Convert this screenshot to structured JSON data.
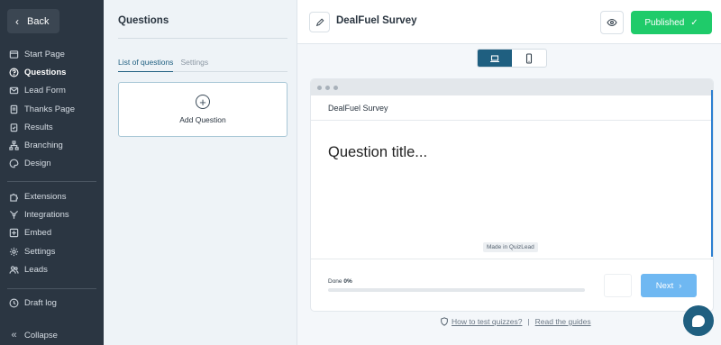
{
  "sidebar": {
    "back_label": "Back",
    "group1": [
      {
        "label": "Start Page",
        "icon": "start-page-icon"
      },
      {
        "label": "Questions",
        "icon": "question-circle-icon",
        "active": true
      },
      {
        "label": "Lead Form",
        "icon": "lead-form-icon"
      },
      {
        "label": "Thanks Page",
        "icon": "thanks-page-icon"
      },
      {
        "label": "Results",
        "icon": "results-icon"
      },
      {
        "label": "Branching",
        "icon": "branching-icon"
      },
      {
        "label": "Design",
        "icon": "palette-icon"
      }
    ],
    "group2": [
      {
        "label": "Extensions",
        "icon": "puzzle-icon"
      },
      {
        "label": "Integrations",
        "icon": "integrations-icon"
      },
      {
        "label": "Embed",
        "icon": "embed-icon"
      },
      {
        "label": "Settings",
        "icon": "gear-icon"
      },
      {
        "label": "Leads",
        "icon": "users-icon"
      }
    ],
    "group3": [
      {
        "label": "Draft log",
        "icon": "clock-icon"
      }
    ],
    "collapse_label": "Collapse"
  },
  "questions_panel": {
    "title": "Questions",
    "tabs": [
      "List of questions",
      "Settings"
    ],
    "add_question_label": "Add Question"
  },
  "topbar": {
    "survey_title": "DealFuel Survey",
    "published_label": "Published"
  },
  "preview": {
    "header_title": "DealFuel Survey",
    "question_placeholder": "Question title...",
    "made_in": "Made in QuizLead",
    "done_label": "Done",
    "done_percent": "0%",
    "progress_fraction": 0,
    "next_label": "Next"
  },
  "help": {
    "test_link": "How to test quizzes?",
    "separator": "|",
    "guides_link": "Read the guides"
  },
  "colors": {
    "sidebar_bg": "#2b3642",
    "accent": "#1f5f80",
    "published_green": "#1fcb6a",
    "next_blue": "#6fb8f2"
  }
}
